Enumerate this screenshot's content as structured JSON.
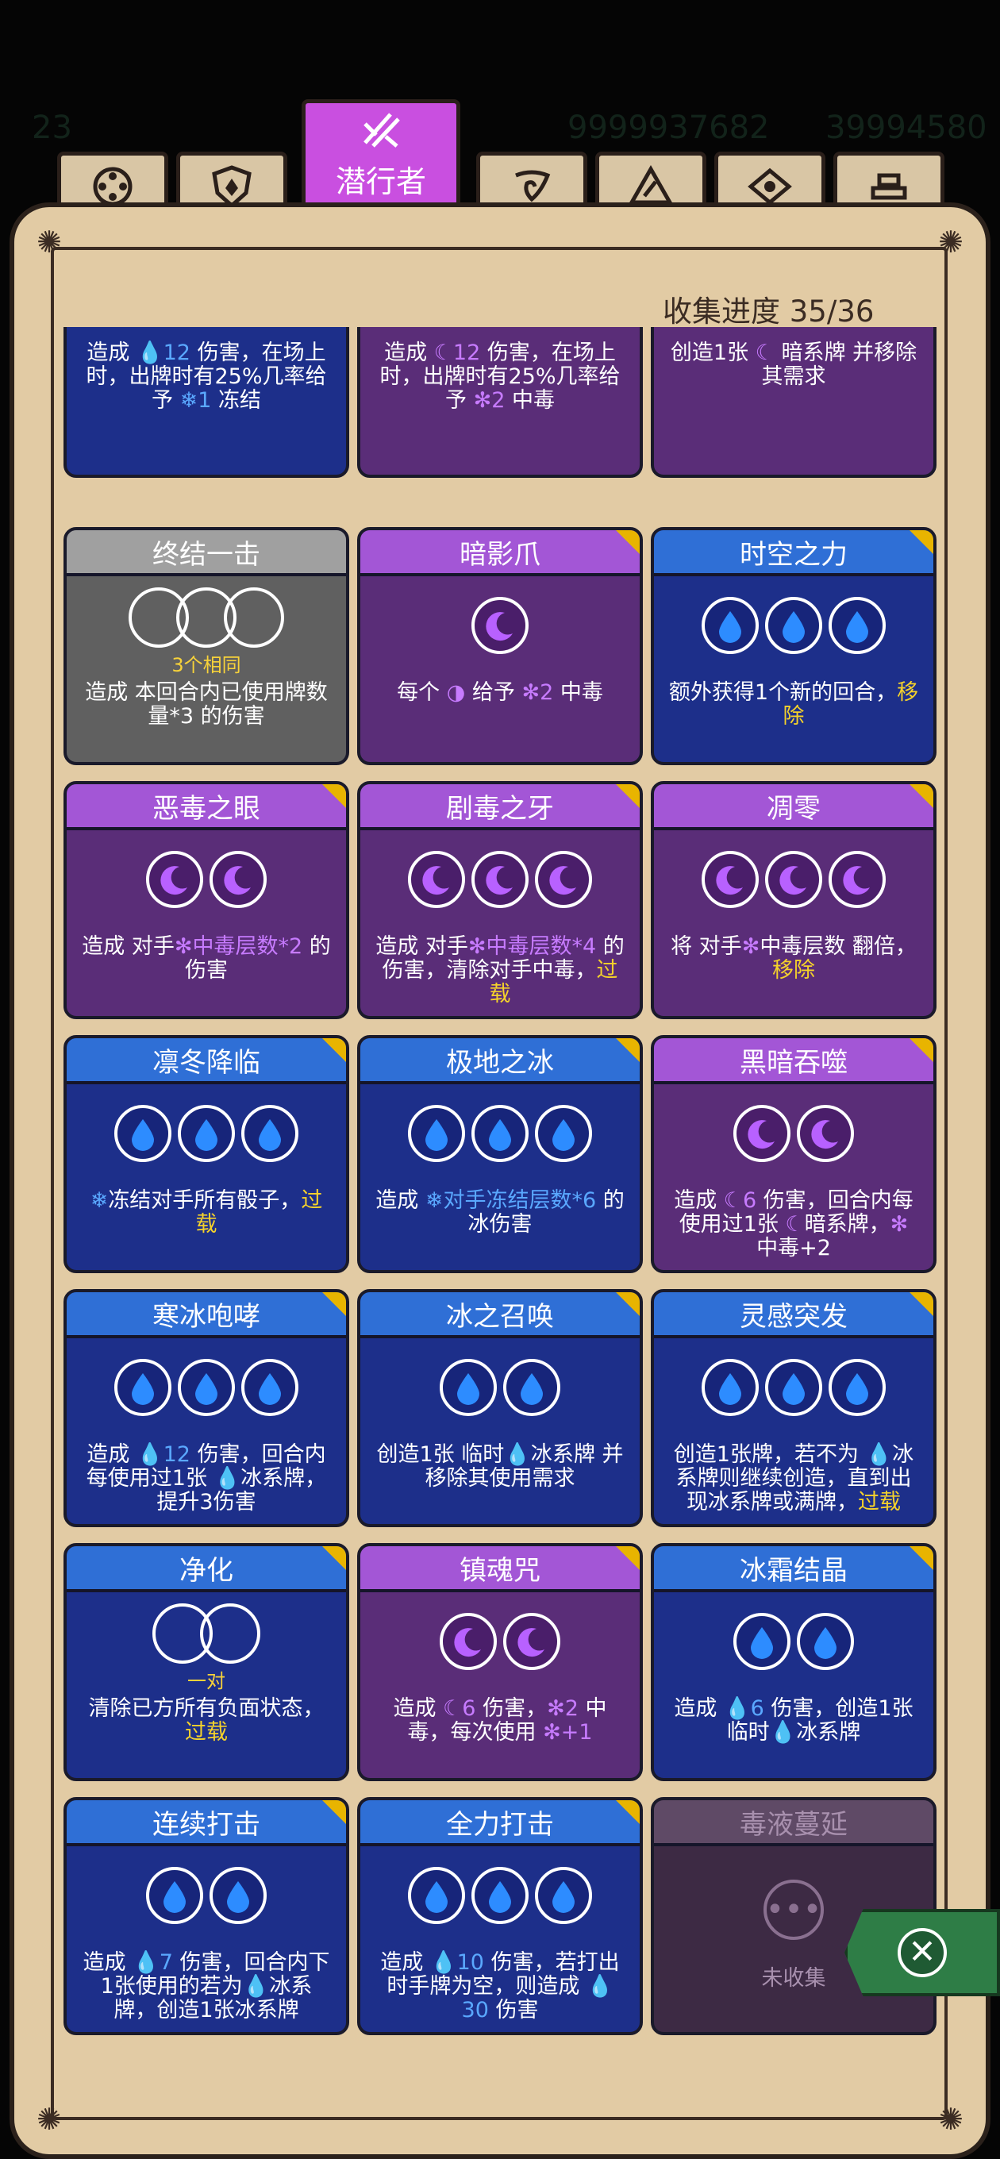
{
  "top_stats": {
    "left": "23",
    "mid_a": "9999937682",
    "mid_b": "39994580"
  },
  "tabs": [
    {
      "icon": "dice-icon"
    },
    {
      "icon": "shield-icon"
    },
    {
      "label": "潜行者",
      "icon": "claw-icon",
      "active": true
    },
    {
      "icon": "spiral-icon"
    },
    {
      "icon": "triangle-icon"
    },
    {
      "icon": "eye-icon"
    },
    {
      "icon": "bars-icon"
    }
  ],
  "progress": {
    "label": "收集进度",
    "value": "35/36"
  },
  "colors": {
    "ice_card": "#1d2f8a",
    "dark_card": "#5a2d78",
    "gray_card": "#606060",
    "highlight": "#f5d22b",
    "tab_active": "#c94fe0",
    "panel": "#e2cba4"
  },
  "cards": [
    {
      "title": "",
      "type": "ice",
      "dice": 3,
      "desc": [
        "造成 ",
        "💧12",
        " 伤害，在场上时，出牌时有25%几率给予 ",
        "❄1",
        " 冻结"
      ]
    },
    {
      "title": "",
      "type": "dark",
      "dice": 3,
      "desc": [
        "造成 ",
        "☾12",
        " 伤害，在场上时，出牌时有25%几率给予 ",
        "✻2",
        " 中毒"
      ]
    },
    {
      "title": "",
      "type": "dark",
      "dice": 2,
      "desc": [
        "创造1张 ",
        "☾",
        " 暗系牌 并移除其需求"
      ]
    },
    {
      "title": "终结一击",
      "type": "gray",
      "req": "3个相同",
      "desc": [
        "造成 本回合内已使用牌数量*3 的伤害"
      ]
    },
    {
      "title": "暗影爪",
      "type": "dark",
      "dice": 1,
      "desc": [
        "每个 ",
        "◑",
        " 给予 ",
        "✻2",
        " 中毒"
      ]
    },
    {
      "title": "时空之力",
      "type": "ice",
      "dice": 3,
      "desc": [
        "额外获得1个新的回合，",
        "移除"
      ]
    },
    {
      "title": "恶毒之眼",
      "type": "dark",
      "dice": 2,
      "desc": [
        "造成 对手",
        "✻中毒层数*2",
        " 的伤害"
      ]
    },
    {
      "title": "剧毒之牙",
      "type": "dark",
      "dice": 3,
      "desc": [
        "造成 对手",
        "✻中毒层数*4",
        " 的伤害，清除对手中毒，",
        "过载"
      ]
    },
    {
      "title": "凋零",
      "type": "dark",
      "dice": 3,
      "desc": [
        "将 对手",
        "✻",
        "中毒层数 翻倍，",
        "移除"
      ]
    },
    {
      "title": "凛冬降临",
      "type": "ice",
      "dice": 3,
      "desc": [
        "❄",
        "冻结对手所有骰子，",
        "过载"
      ]
    },
    {
      "title": "极地之冰",
      "type": "ice",
      "dice": 3,
      "desc": [
        "造成 ",
        "❄对手冻结层数*6",
        " 的冰伤害"
      ]
    },
    {
      "title": "黑暗吞噬",
      "type": "dark",
      "dice": 2,
      "desc": [
        "造成 ",
        "☾6",
        " 伤害，回合内每使用过1张 ",
        "☾",
        "暗系牌，",
        "✻",
        " 中毒+2"
      ]
    },
    {
      "title": "寒冰咆哮",
      "type": "ice",
      "dice": 3,
      "desc": [
        "造成 ",
        "💧12",
        " 伤害，回合内每使用过1张 ",
        "💧",
        "冰系牌，提升3伤害"
      ]
    },
    {
      "title": "冰之召唤",
      "type": "ice",
      "dice": 2,
      "desc": [
        "创造1张 临时",
        "💧",
        "冰系牌 并移除其使用需求"
      ]
    },
    {
      "title": "灵感突发",
      "type": "ice",
      "dice": 3,
      "desc": [
        "创造1张牌，若不为 ",
        "💧",
        "冰系牌则继续创造，直到出现冰系牌或满牌，",
        "过载"
      ]
    },
    {
      "title": "净化",
      "type": "ice",
      "req": "一对",
      "desc": [
        "清除已方所有负面状态，",
        "过载"
      ]
    },
    {
      "title": "镇魂咒",
      "type": "dark",
      "dice": 2,
      "desc": [
        "造成 ",
        "☾6",
        " 伤害，",
        "✻2",
        " 中毒，每次使用 ",
        "✻+1"
      ]
    },
    {
      "title": "冰霜结晶",
      "type": "ice",
      "dice": 2,
      "desc": [
        "造成 ",
        "💧6",
        " 伤害，创造1张临时",
        "💧",
        "冰系牌"
      ]
    },
    {
      "title": "连续打击",
      "type": "ice",
      "dice": 2,
      "desc": [
        "造成 ",
        "💧7",
        " 伤害，回合内下1张使用的若为",
        "💧",
        "冰系牌，创造1张冰系牌"
      ]
    },
    {
      "title": "全力打击",
      "type": "ice",
      "dice": 3,
      "desc": [
        "造成 ",
        "💧10",
        " 伤害，若打出时手牌为空，则造成 ",
        "💧30",
        " 伤害"
      ]
    },
    {
      "title": "毒液蔓延",
      "type": "locked",
      "status": "未收集"
    }
  ]
}
